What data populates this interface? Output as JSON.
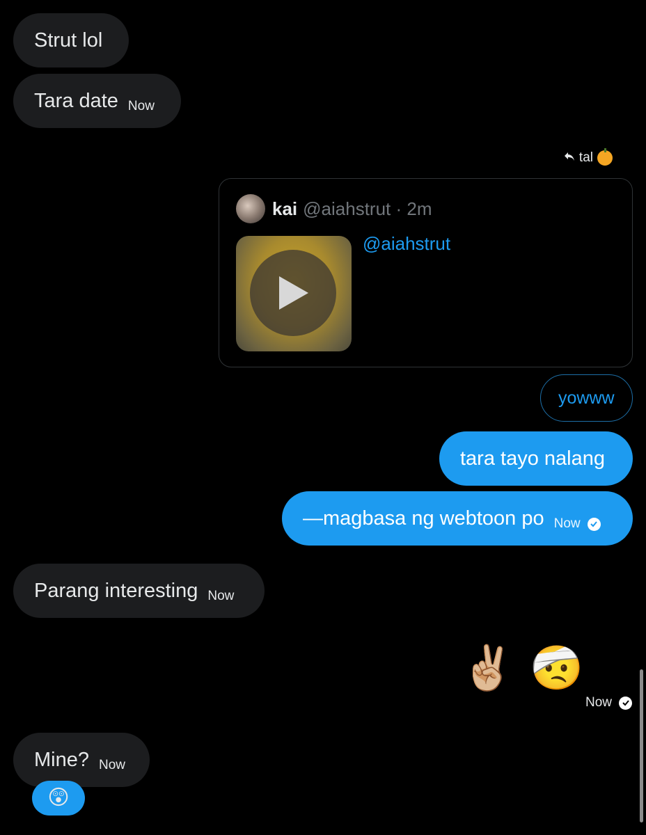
{
  "messages": {
    "m1": {
      "text": "Strut lol"
    },
    "m2": {
      "text": "Tara date",
      "time": "Now"
    },
    "reply_to": {
      "label": "tal"
    },
    "quoted_post": {
      "name": "kai",
      "handle": "@aiahstrut · 2m",
      "body_link": "@aiahstrut"
    },
    "m3": {
      "text": "yowww"
    },
    "m4": {
      "text": "tara tayo nalang"
    },
    "m5": {
      "text": "—magbasa ng webtoon po",
      "time": "Now"
    },
    "m6": {
      "text": "Parang interesting",
      "time": "Now"
    },
    "m7": {
      "emoji": [
        "✌🏼",
        "🤕"
      ],
      "time": "Now"
    },
    "m8": {
      "text": "Mine?",
      "time": "Now",
      "reaction": "😲"
    }
  },
  "colors": {
    "background": "#000000",
    "incoming_bubble": "#1c1d1f",
    "outgoing_bubble": "#1d9bf0",
    "link": "#1d9bf0"
  },
  "icons": {
    "reply": "reply-arrow-icon",
    "seal": "pumpkin-icon",
    "play": "play-icon",
    "delivered": "check-circle-icon"
  }
}
